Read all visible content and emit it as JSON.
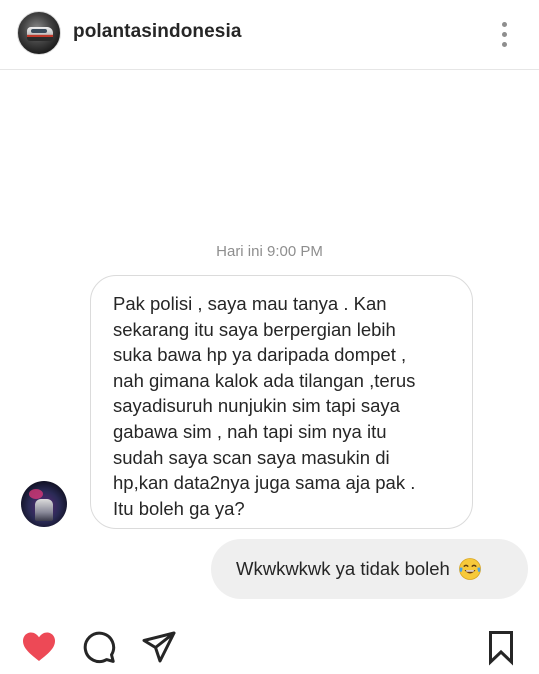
{
  "header": {
    "username": "polantasindonesia",
    "more_icon": "more-vertical-icon"
  },
  "thread": {
    "timestamp": "Hari ini 9:00 PM",
    "incoming_message": {
      "lines": [
        "Pak polisi , saya mau tanya . Kan",
        "sekarang itu saya berpergian lebih",
        "suka bawa hp ya daripada dompet ,",
        "nah gimana kalok ada tilangan ,terus",
        "sayadisuruh nunjukin sim tapi saya",
        "gabawa sim , nah tapi sim nya itu",
        "sudah saya scan saya masukin di",
        "hp,kan data2nya juga sama aja pak .",
        "Itu boleh ga ya?"
      ]
    },
    "outgoing_message": {
      "text": "Wkwkwkwk ya tidak boleh",
      "emoji": "😂"
    }
  },
  "actions": {
    "like_icon": "heart-icon",
    "comment_icon": "comment-icon",
    "share_icon": "send-icon",
    "save_icon": "bookmark-icon",
    "like_color": "#ed4956"
  }
}
